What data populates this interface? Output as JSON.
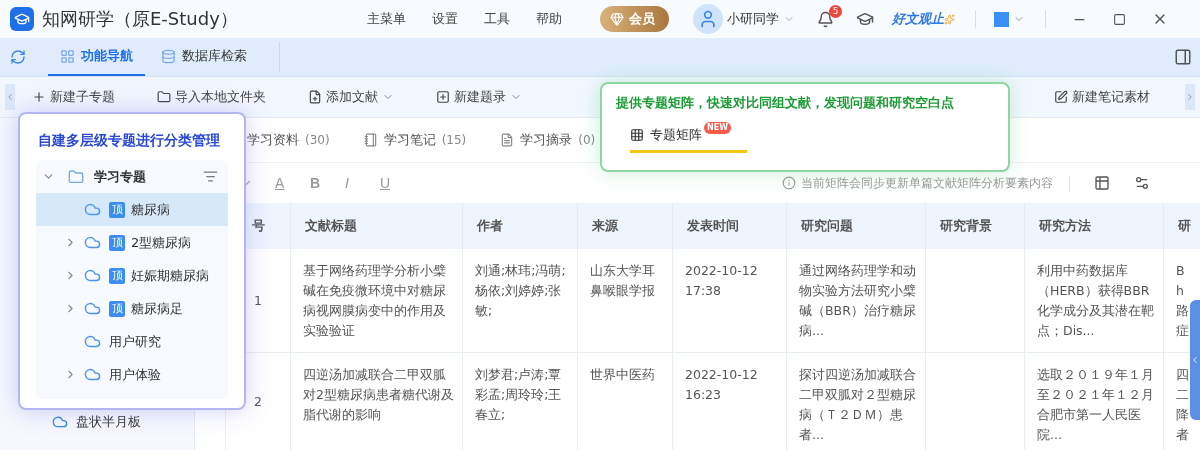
{
  "app": {
    "title": "知网研学（原E-Study）",
    "menu": [
      "主菜单",
      "设置",
      "工具",
      "帮助"
    ],
    "member_label": "会员",
    "user_name": "小研同学",
    "notification_count": "5",
    "promo": "好文观止"
  },
  "nav_tabs": [
    {
      "label": "功能导航",
      "selected": true
    },
    {
      "label": "数据库检索",
      "selected": false
    }
  ],
  "toolbar": [
    {
      "label": "新建子专题",
      "kind": "plus",
      "dropdown": false
    },
    {
      "label": "导入本地文件夹",
      "kind": "folder",
      "dropdown": false
    },
    {
      "label": "添加文献",
      "kind": "doc",
      "dropdown": true
    },
    {
      "label": "新建题录",
      "kind": "box",
      "dropdown": true
    },
    {
      "label": "新建笔记素材",
      "kind": "note",
      "dropdown": false
    }
  ],
  "sidebar": {
    "items": [
      "盘状半月板"
    ]
  },
  "doc_tabs": [
    {
      "label": "学习资料",
      "count": "(30)"
    },
    {
      "label": "学习笔记",
      "count": "(15)"
    },
    {
      "label": "学习摘录",
      "count": "(0)"
    }
  ],
  "format_bar": {
    "buttons": [
      {
        "label": "A",
        "kind": "color"
      },
      {
        "label": "B",
        "kind": "bold"
      },
      {
        "label": "I",
        "kind": "italic"
      },
      {
        "label": "U",
        "kind": "underline"
      }
    ],
    "notice": "当前矩阵会同步更新单篇文献矩阵分析要素内容"
  },
  "table": {
    "columns": [
      "号",
      "文献标题",
      "作者",
      "来源",
      "发表时间",
      "研究问题",
      "研究背景",
      "研究方法",
      "研"
    ],
    "rows": [
      [
        "1",
        "基于网络药理学分析小檗碱在免疫微环境中对糖尿病视网膜病变中的作用及实验验证",
        "刘通;林玮;冯萌;杨依;刘婷婷;张敏;",
        "山东大学耳鼻喉眼学报",
        "2022-10-12 17:38",
        "通过网络药理学和动物实验方法研究小檗碱（BBR）治疗糖尿病...",
        null,
        "利用中药数据库（HERB）获得BBR化学成分及其潜在靶点；Dis...",
        "Bh路症"
      ],
      [
        "2",
        "四逆汤加减联合二甲双胍对2型糖尿病患者糖代谢及脂代谢的影响",
        "刘梦君;卢涛;覃彩孟;周玲玲;王春立;",
        "世界中医药",
        "2022-10-12 16:23",
        "探讨四逆汤加减联合二甲双胍对２型糖尿病（Ｔ２ＤＭ）患者...",
        null,
        "选取２０１９年１月至２０２１年１２月合肥市第一人民医院...",
        "四二降者"
      ]
    ]
  },
  "topic_popup": {
    "heading": "自建多层级专题进行分类管理",
    "root": {
      "label": "学习专题",
      "expanded": true,
      "children": [
        {
          "label": "糖尿病",
          "badge": "顶",
          "selected": true,
          "kind": "leaf"
        },
        {
          "label": "2型糖尿病",
          "badge": "顶",
          "selected": false,
          "kind": "branch"
        },
        {
          "label": "妊娠期糖尿病",
          "badge": "顶",
          "selected": false,
          "kind": "branch"
        },
        {
          "label": "糖尿病足",
          "badge": "顶",
          "selected": false,
          "kind": "branch"
        },
        {
          "label": "用户研究",
          "selected": false,
          "kind": "leaf"
        },
        {
          "label": "用户体验",
          "selected": false,
          "kind": "branch"
        }
      ]
    }
  },
  "matrix_popup": {
    "heading": "提供专题矩阵，快速对比同组文献，发现问题和研究空白点",
    "tab": {
      "label": "专题矩阵",
      "badge": "NEW",
      "selected": true
    }
  }
}
